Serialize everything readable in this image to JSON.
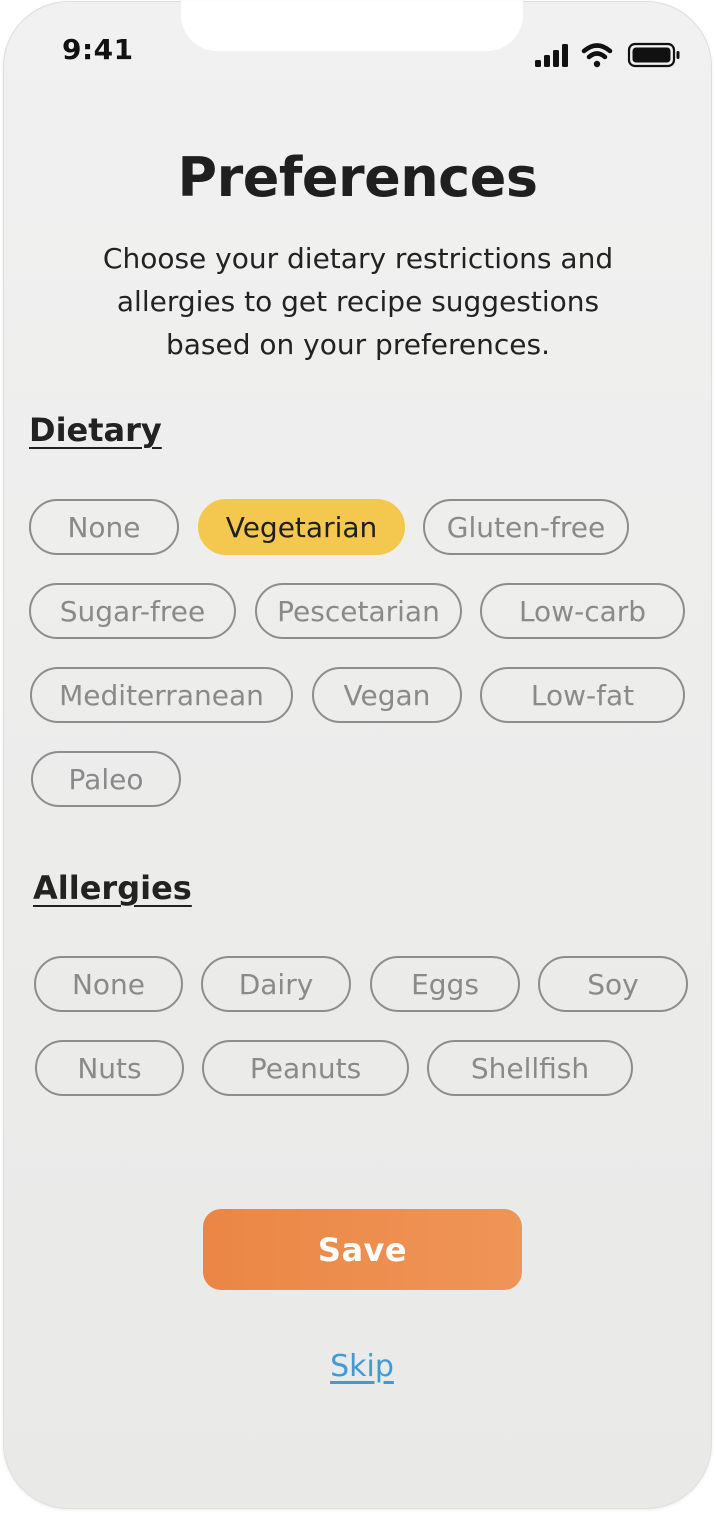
{
  "status_bar": {
    "time": "9:41",
    "icons": [
      "cellular-signal-icon",
      "wifi-icon",
      "battery-icon"
    ]
  },
  "title": "Preferences",
  "subtitle": "Choose your dietary restrictions and allergies to get recipe suggestions based on your preferences.",
  "dietary": {
    "heading": "Dietary",
    "options": [
      {
        "label": "None",
        "selected": false
      },
      {
        "label": "Vegetarian",
        "selected": true
      },
      {
        "label": "Gluten-free",
        "selected": false
      },
      {
        "label": "Sugar-free",
        "selected": false
      },
      {
        "label": "Pescetarian",
        "selected": false
      },
      {
        "label": "Low-carb",
        "selected": false
      },
      {
        "label": "Mediterranean",
        "selected": false
      },
      {
        "label": "Vegan",
        "selected": false
      },
      {
        "label": "Low-fat",
        "selected": false
      },
      {
        "label": "Paleo",
        "selected": false
      }
    ]
  },
  "allergies": {
    "heading": "Allergies",
    "options": [
      {
        "label": "None",
        "selected": false
      },
      {
        "label": "Dairy",
        "selected": false
      },
      {
        "label": "Eggs",
        "selected": false
      },
      {
        "label": "Soy",
        "selected": false
      },
      {
        "label": "Nuts",
        "selected": false
      },
      {
        "label": "Peanuts",
        "selected": false
      },
      {
        "label": "Shellfish",
        "selected": false
      }
    ]
  },
  "actions": {
    "save_label": "Save",
    "skip_label": "Skip"
  },
  "colors": {
    "selected_chip": "#f4c84e",
    "save_button": "#ec8a4b",
    "skip_link": "#3f9bd6"
  }
}
